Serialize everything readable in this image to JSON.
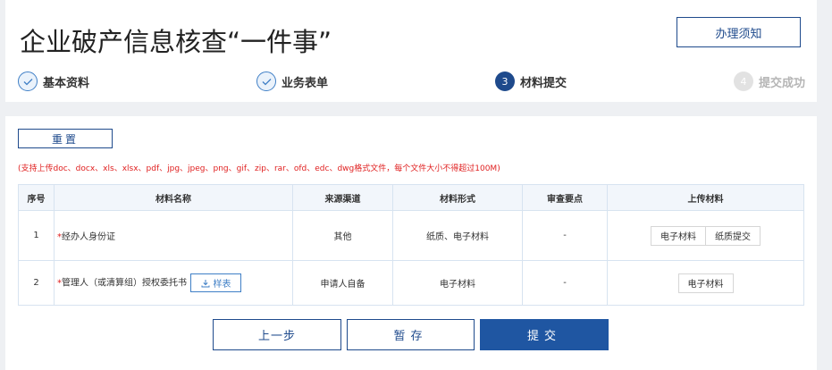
{
  "header": {
    "title": "企业破产信息核查“一件事”",
    "guide_button": "办理须知"
  },
  "steps": [
    {
      "number": "",
      "label": "基本资料",
      "state": "done"
    },
    {
      "number": "",
      "label": "业务表单",
      "state": "done"
    },
    {
      "number": "3",
      "label": "材料提交",
      "state": "active"
    },
    {
      "number": "4",
      "label": "提交成功",
      "state": "todo"
    }
  ],
  "toolbar": {
    "reset_button": "重置"
  },
  "notice": "(支持上传doc、docx、xls、xlsx、pdf、jpg、jpeg、png、gif、zip、rar、ofd、edc、dwg格式文件，每个文件大小不得超过100M)",
  "table": {
    "headers": [
      "序号",
      "材料名称",
      "来源渠道",
      "材料形式",
      "审查要点",
      "上传材料"
    ],
    "rows": [
      {
        "index": "1",
        "required_mark": "*",
        "name": "经办人身份证",
        "source": "其他",
        "form": "纸质、电子材料",
        "review": "-",
        "upload_buttons": [
          "电子材料",
          "纸质提交"
        ]
      },
      {
        "index": "2",
        "required_mark": "*",
        "name": "管理人（或清算组）授权委托书",
        "sample_button": "样表",
        "source": "申请人自备",
        "form": "电子材料",
        "review": "-",
        "upload_buttons": [
          "电子材料"
        ]
      }
    ]
  },
  "footer": {
    "prev_button": "上一步",
    "save_button": "暂存",
    "submit_button": "提交"
  },
  "colors": {
    "primary": "#1e4a8c",
    "submit": "#1f56a2",
    "required": "#e02020",
    "step_done": "#3f7fc6",
    "step_todo": "#e2e2e2"
  },
  "icons": {
    "step_done": "check-icon",
    "sample": "download-icon"
  }
}
